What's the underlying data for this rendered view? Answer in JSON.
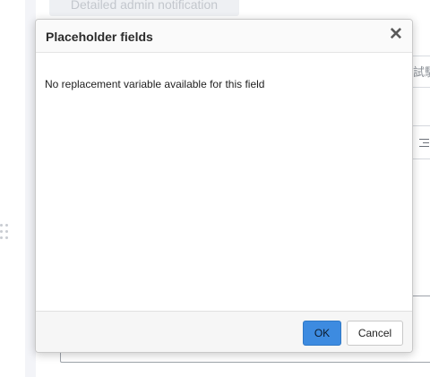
{
  "background": {
    "tab_label": "Detailed admin notification",
    "right_field_text": "試験"
  },
  "modal": {
    "title": "Placeholder fields",
    "close_glyph": "✕",
    "message": "No replacement variable available for this field",
    "ok_label": "OK",
    "cancel_label": "Cancel"
  },
  "colors": {
    "ok_button": "#3d8be0",
    "modal_header": "#fafafa",
    "modal_footer": "#f6f6f6"
  },
  "icons": {
    "close": "close-icon",
    "drag_handle": "drag-handle-icon",
    "align": "align-right-icon"
  }
}
